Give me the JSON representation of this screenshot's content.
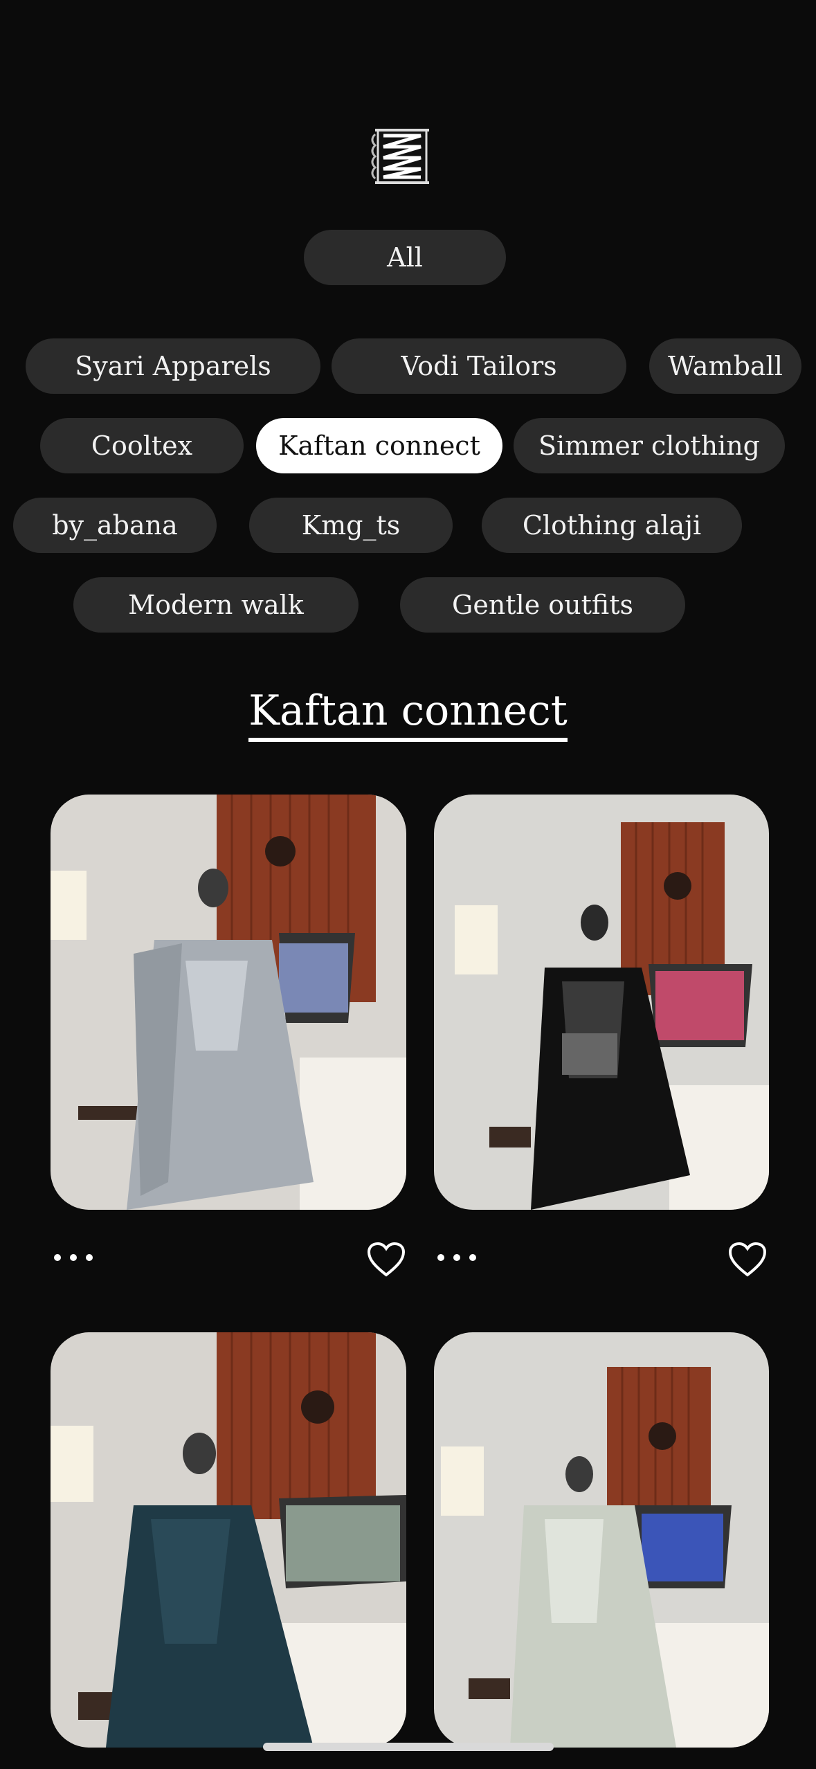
{
  "header": {
    "logo_icon": "tailor-logo-icon"
  },
  "filters": {
    "all_label": "All",
    "items": [
      "Syari Apparels",
      "Vodi Tailors",
      "Wamball",
      "Cooltex",
      "Kaftan connect",
      "Simmer clothing",
      "by_abana",
      "Kmg_ts",
      "Clothing alaji",
      "Modern walk",
      "Gentle outfits"
    ],
    "selected": "Kaftan connect"
  },
  "section": {
    "title": "Kaftan connect"
  },
  "products": [
    {
      "image": "grey kaftan on mannequin",
      "more_icon": "more-dots-icon",
      "like_icon": "heart-icon"
    },
    {
      "image": "black kaftan on mannequin",
      "more_icon": "more-dots-icon",
      "like_icon": "heart-icon"
    },
    {
      "image": "teal kaftan on mannequin"
    },
    {
      "image": "sage kaftan on mannequin"
    }
  ],
  "colors": {
    "background": "#0b0b0b",
    "pill": "#2b2b2b",
    "pill_active": "#ffffff"
  }
}
